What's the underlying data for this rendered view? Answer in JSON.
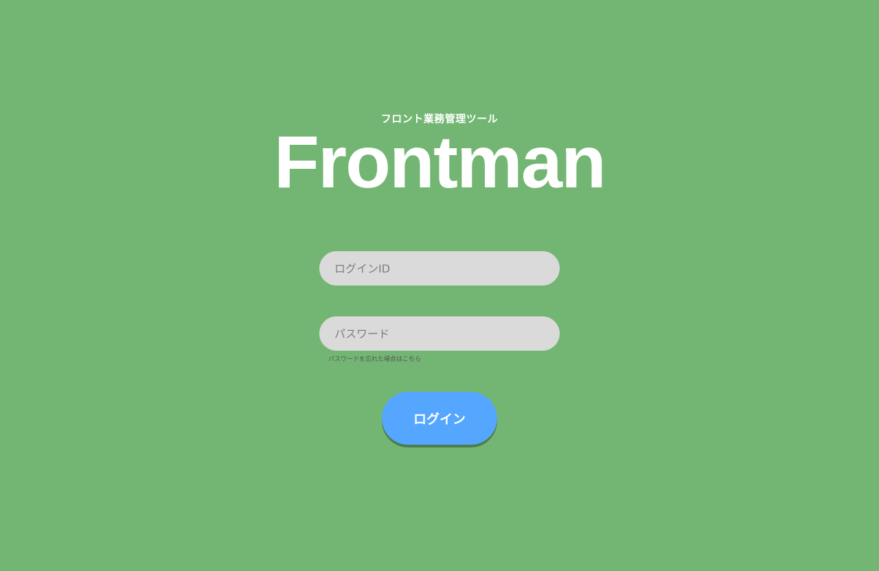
{
  "brand": {
    "subtitle": "フロント業務管理ツール",
    "title": "Frontman"
  },
  "form": {
    "login_id_placeholder": "ログインID",
    "password_placeholder": "パスワード",
    "forgot_password_link": "パスワードを忘れた場合はこちら",
    "login_button_label": "ログイン"
  },
  "colors": {
    "background": "#73b673",
    "input_background": "#dadada",
    "button_background": "#55a6ff",
    "button_shadow": "#4d7d4d",
    "text_on_brand": "#ffffff"
  }
}
